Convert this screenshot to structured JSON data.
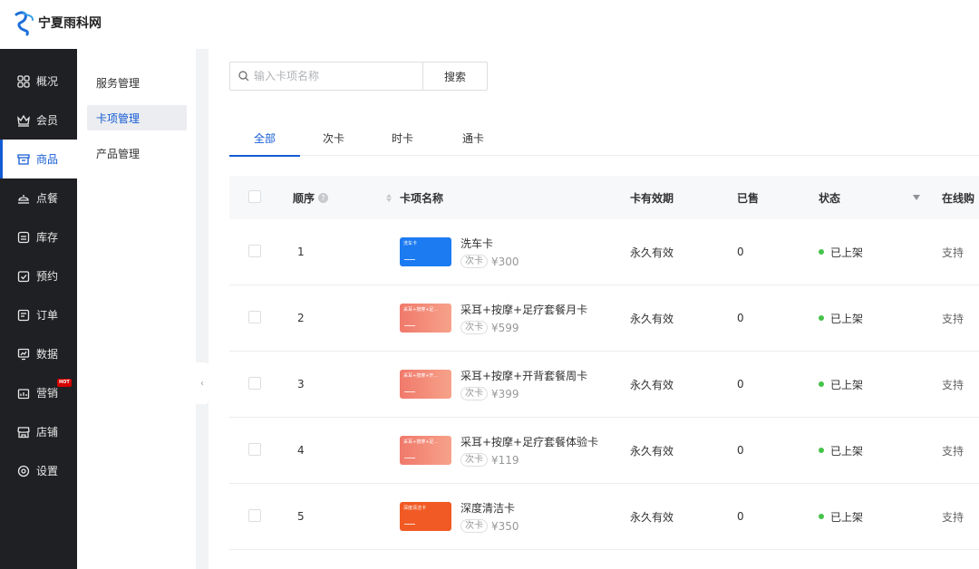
{
  "brand": {
    "name": "宁夏雨科网"
  },
  "nav": [
    {
      "label": "概况",
      "icon": "overview-icon"
    },
    {
      "label": "会员",
      "icon": "crown-icon"
    },
    {
      "label": "商品",
      "icon": "shop-icon",
      "active": true
    },
    {
      "label": "点餐",
      "icon": "dish-icon"
    },
    {
      "label": "库存",
      "icon": "inventory-icon"
    },
    {
      "label": "预约",
      "icon": "calendar-check-icon"
    },
    {
      "label": "订单",
      "icon": "order-icon"
    },
    {
      "label": "数据",
      "icon": "chart-icon"
    },
    {
      "label": "营销",
      "icon": "marketing-icon",
      "badge": "HOT"
    },
    {
      "label": "店铺",
      "icon": "store-icon"
    },
    {
      "label": "设置",
      "icon": "settings-icon"
    }
  ],
  "subnav": [
    {
      "label": "服务管理"
    },
    {
      "label": "卡项管理",
      "active": true
    },
    {
      "label": "产品管理"
    }
  ],
  "search": {
    "placeholder": "输入卡项名称",
    "button": "搜索"
  },
  "tabs": [
    {
      "label": "全部",
      "active": true
    },
    {
      "label": "次卡"
    },
    {
      "label": "时卡"
    },
    {
      "label": "通卡"
    }
  ],
  "table": {
    "headers": {
      "order": "顺序",
      "help": "?",
      "name": "卡项名称",
      "validity": "卡有效期",
      "sold": "已售",
      "status": "状态",
      "online": "在线购"
    },
    "rows": [
      {
        "order": "1",
        "thumb_text": "洗车卡",
        "thumb_color": "blue",
        "name": "洗车卡",
        "tag": "次卡",
        "price": "¥300",
        "validity": "永久有效",
        "sold": "0",
        "status": "已上架",
        "online": "支持"
      },
      {
        "order": "2",
        "thumb_text": "采耳+按摩+足...",
        "thumb_color": "pink",
        "name": "采耳+按摩+足疗套餐月卡",
        "tag": "次卡",
        "price": "¥599",
        "validity": "永久有效",
        "sold": "0",
        "status": "已上架",
        "online": "支持"
      },
      {
        "order": "3",
        "thumb_text": "采耳+按摩+开...",
        "thumb_color": "pink",
        "name": "采耳+按摩+开背套餐周卡",
        "tag": "次卡",
        "price": "¥399",
        "validity": "永久有效",
        "sold": "0",
        "status": "已上架",
        "online": "支持"
      },
      {
        "order": "4",
        "thumb_text": "采耳+按摩+足...",
        "thumb_color": "pink",
        "name": "采耳+按摩+足疗套餐体验卡",
        "tag": "次卡",
        "price": "¥119",
        "validity": "永久有效",
        "sold": "0",
        "status": "已上架",
        "online": "支持"
      },
      {
        "order": "5",
        "thumb_text": "深度清洁卡",
        "thumb_color": "orange",
        "name": "深度清洁卡",
        "tag": "次卡",
        "price": "¥350",
        "validity": "永久有效",
        "sold": "0",
        "status": "已上架",
        "online": "支持"
      }
    ]
  },
  "colors": {
    "primary": "#155bd4",
    "nav_bg": "#1f2023",
    "status_green": "#45c34a"
  }
}
